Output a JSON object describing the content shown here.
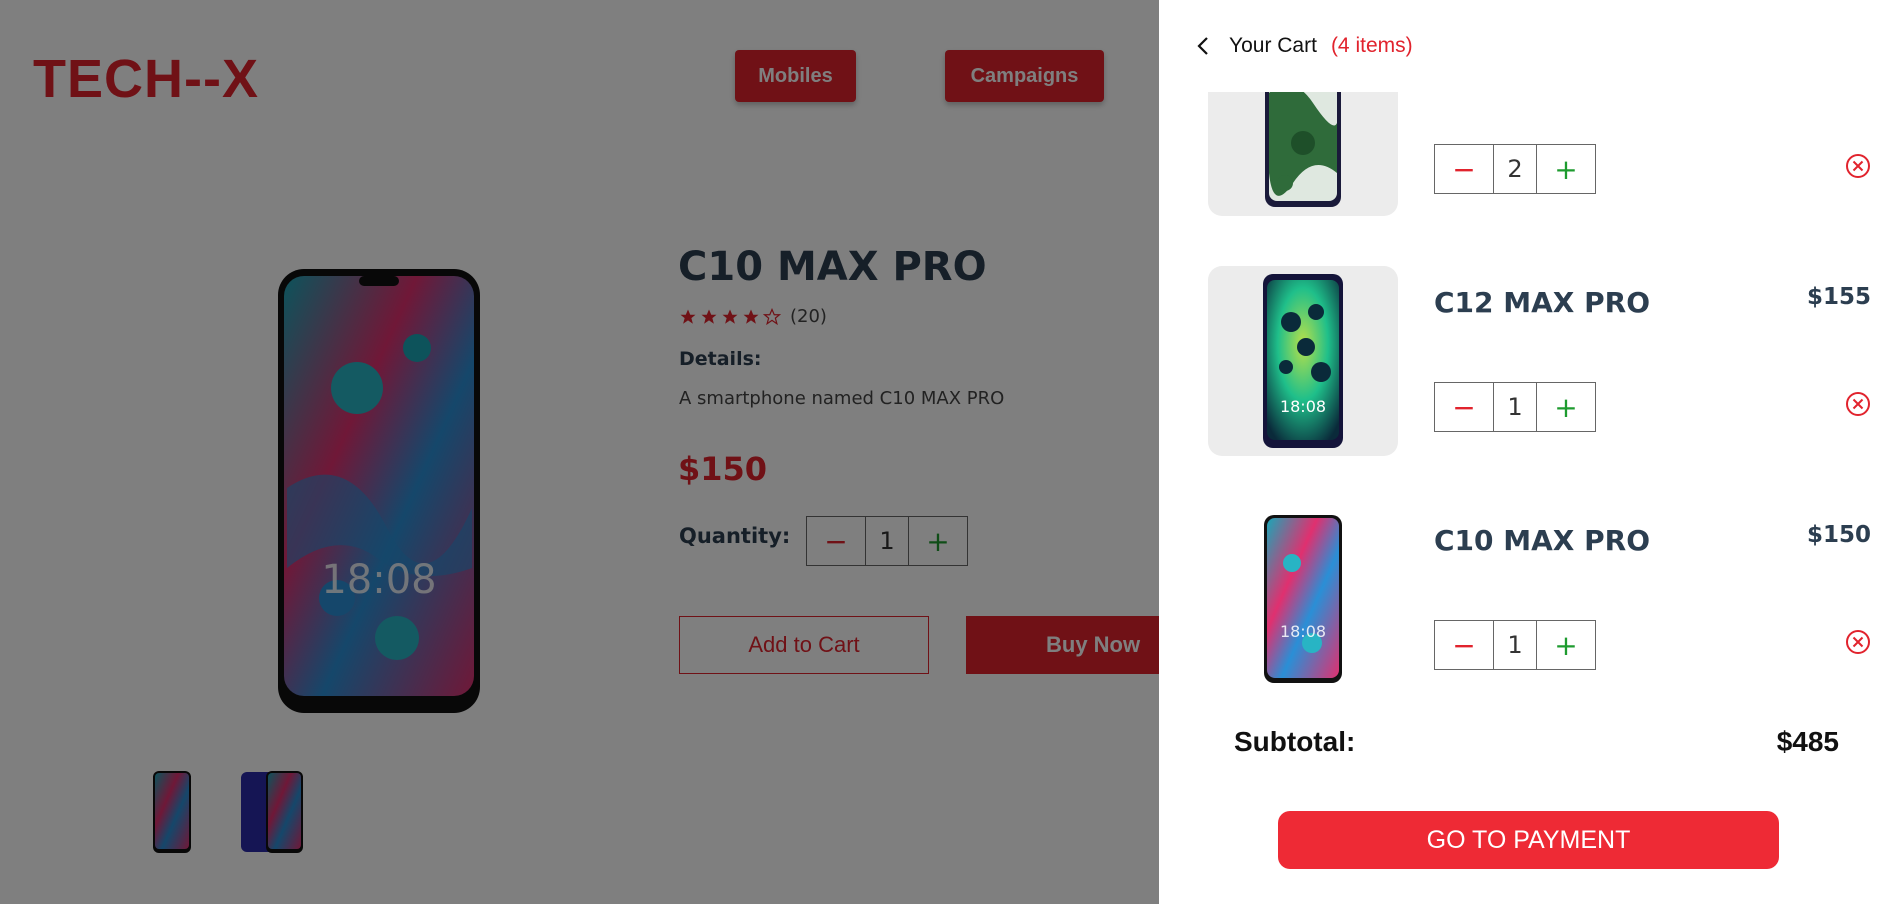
{
  "header": {
    "logo": "TECH--X",
    "nav": [
      {
        "label": "Mobiles"
      },
      {
        "label": "Campaigns"
      }
    ]
  },
  "product": {
    "title": "C10 MAX PRO",
    "rating": {
      "stars": 4,
      "max": 5,
      "count_label": "(20)"
    },
    "details_label": "Details:",
    "details_text": "A smartphone named C10 MAX PRO",
    "price": "$150",
    "quantity_label": "Quantity:",
    "quantity": "1",
    "add_to_cart": "Add to Cart",
    "buy_now": "Buy Now",
    "stepper": {
      "minus": "−",
      "plus": "+"
    }
  },
  "cart": {
    "title": "Your Cart",
    "count_label": "(4 items)",
    "items": [
      {
        "name": "",
        "price": "",
        "quantity": "2",
        "image": "phone-green-marble"
      },
      {
        "name": "C12 MAX PRO",
        "price": "$155",
        "quantity": "1",
        "image": "phone-green-cells"
      },
      {
        "name": "C10 MAX PRO",
        "price": "$150",
        "quantity": "1",
        "image": "phone-pink-blue"
      }
    ],
    "subtotal_label": "Subtotal:",
    "subtotal_value": "$485",
    "payment_button": "GO TO PAYMENT",
    "stepper": {
      "minus": "−",
      "plus": "+"
    }
  },
  "colors": {
    "accent": "#e1232d",
    "plus_green": "#1e9b2f",
    "heading": "#2c3e50",
    "overlay": "rgba(0,0,0,0.5)"
  },
  "icons": {
    "back": "chevron-left-icon",
    "remove": "close-circle-icon",
    "star_full": "star-icon",
    "star_empty": "star-outline-icon"
  }
}
